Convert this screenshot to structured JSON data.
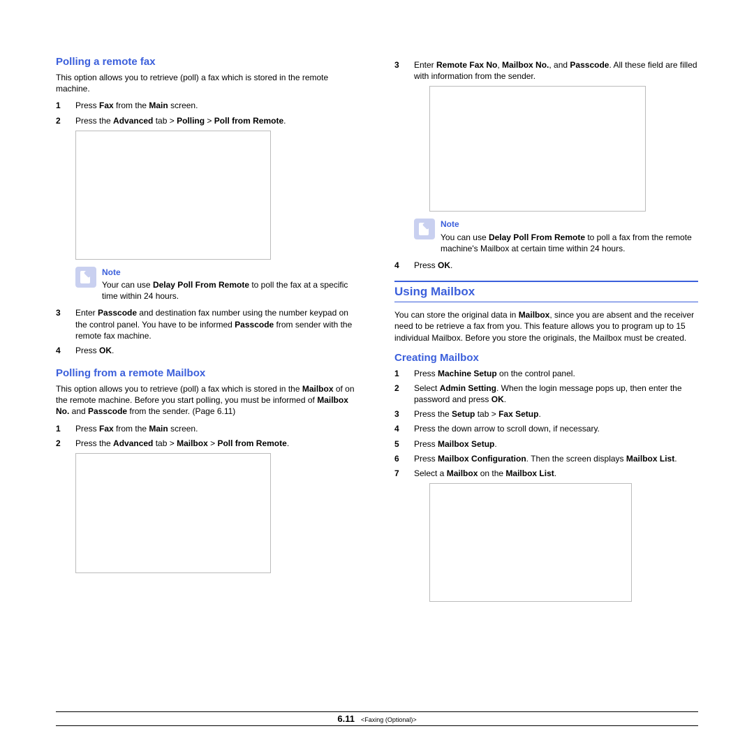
{
  "left": {
    "sec1": {
      "title": "Polling a remote fax",
      "intro": "This option allows you to retrieve (poll) a fax which is stored in the remote machine.",
      "s1_pre": "Press ",
      "s1_b1": "Fax",
      "s1_mid": " from the ",
      "s1_b2": "Main",
      "s1_post": " screen.",
      "s2_pre": "Press the ",
      "s2_b1": "Advanced",
      "s2_mid1": " tab > ",
      "s2_b2": "Polling",
      "s2_mid2": " > ",
      "s2_b3": "Poll from Remote",
      "s2_post": ".",
      "note_label": "Note",
      "note_pre": "Your can use ",
      "note_b": "Delay Poll From Remote",
      "note_post": " to poll the fax at a specific time within 24 hours.",
      "s3_pre": "Enter ",
      "s3_b1": "Passcode",
      "s3_mid": " and destination fax number using the number keypad on the control panel. You have to be informed ",
      "s3_b2": "Passcode",
      "s3_post": " from sender with the remote fax machine.",
      "s4_pre": "Press ",
      "s4_b": "OK",
      "s4_post": "."
    },
    "sec2": {
      "title": "Polling from a remote Mailbox",
      "intro_pre": "This option allows you to retrieve (poll) a fax which is stored in the ",
      "intro_b1": "Mailbox",
      "intro_mid1": " of on the remote machine. Before you start polling, you must be informed of ",
      "intro_b2": "Mailbox No.",
      "intro_mid2": " and ",
      "intro_b3": "Passcode",
      "intro_post": " from the sender. (Page 6.11)",
      "s1_pre": "Press ",
      "s1_b1": "Fax",
      "s1_mid": " from the ",
      "s1_b2": "Main",
      "s1_post": " screen.",
      "s2_pre": "Press the ",
      "s2_b1": "Advanced",
      "s2_mid1": " tab > ",
      "s2_b2": "Mailbox",
      "s2_mid2": " > ",
      "s2_b3": "Poll from Remote",
      "s2_post": "."
    }
  },
  "right": {
    "cont": {
      "s3_pre": "Enter ",
      "s3_b1": "Remote Fax No",
      "s3_c1": ", ",
      "s3_b2": "Mailbox No.",
      "s3_c2": ", and ",
      "s3_b3": "Passcode",
      "s3_post": ". All these field are filled with information from the sender.",
      "note_label": "Note",
      "note_pre": "You can use ",
      "note_b": "Delay Poll From Remote",
      "note_post": " to poll a fax from the remote machine's Mailbox at certain time within 24 hours.",
      "s4_pre": "Press ",
      "s4_b": "OK",
      "s4_post": "."
    },
    "using_title": "Using Mailbox",
    "using_intro_pre": "You can store the original data in ",
    "using_intro_b": "Mailbox",
    "using_intro_post": ", since you are absent and the receiver need to be retrieve a fax from you. This feature allows you to program up to 15 individual Mailbox. Before you store the originals, the Mailbox must be created.",
    "creating": {
      "title": "Creating Mailbox",
      "s1_pre": "Press ",
      "s1_b": "Machine Setup",
      "s1_post": " on the control panel.",
      "s2_pre": "Select ",
      "s2_b1": "Admin Setting",
      "s2_mid": ". When the login message pops up, then enter the password and press ",
      "s2_b2": "OK",
      "s2_post": ".",
      "s3_pre": "Press the ",
      "s3_b1": "Setup",
      "s3_mid": " tab > ",
      "s3_b2": "Fax Setup",
      "s3_post": ".",
      "s4": "Press the down arrow to scroll down, if necessary.",
      "s5_pre": "Press ",
      "s5_b": "Mailbox Setup",
      "s5_post": ".",
      "s6_pre": "Press ",
      "s6_b1": "Mailbox Configuration",
      "s6_mid": ". Then the screen displays ",
      "s6_b2": "Mailbox List",
      "s6_post": ".",
      "s7_pre": "Select a ",
      "s7_b1": "Mailbox",
      "s7_mid": " on the ",
      "s7_b2": "Mailbox List",
      "s7_post": "."
    }
  },
  "footer": {
    "page": "6.11",
    "chapter": "<Faxing (Optional)>"
  }
}
